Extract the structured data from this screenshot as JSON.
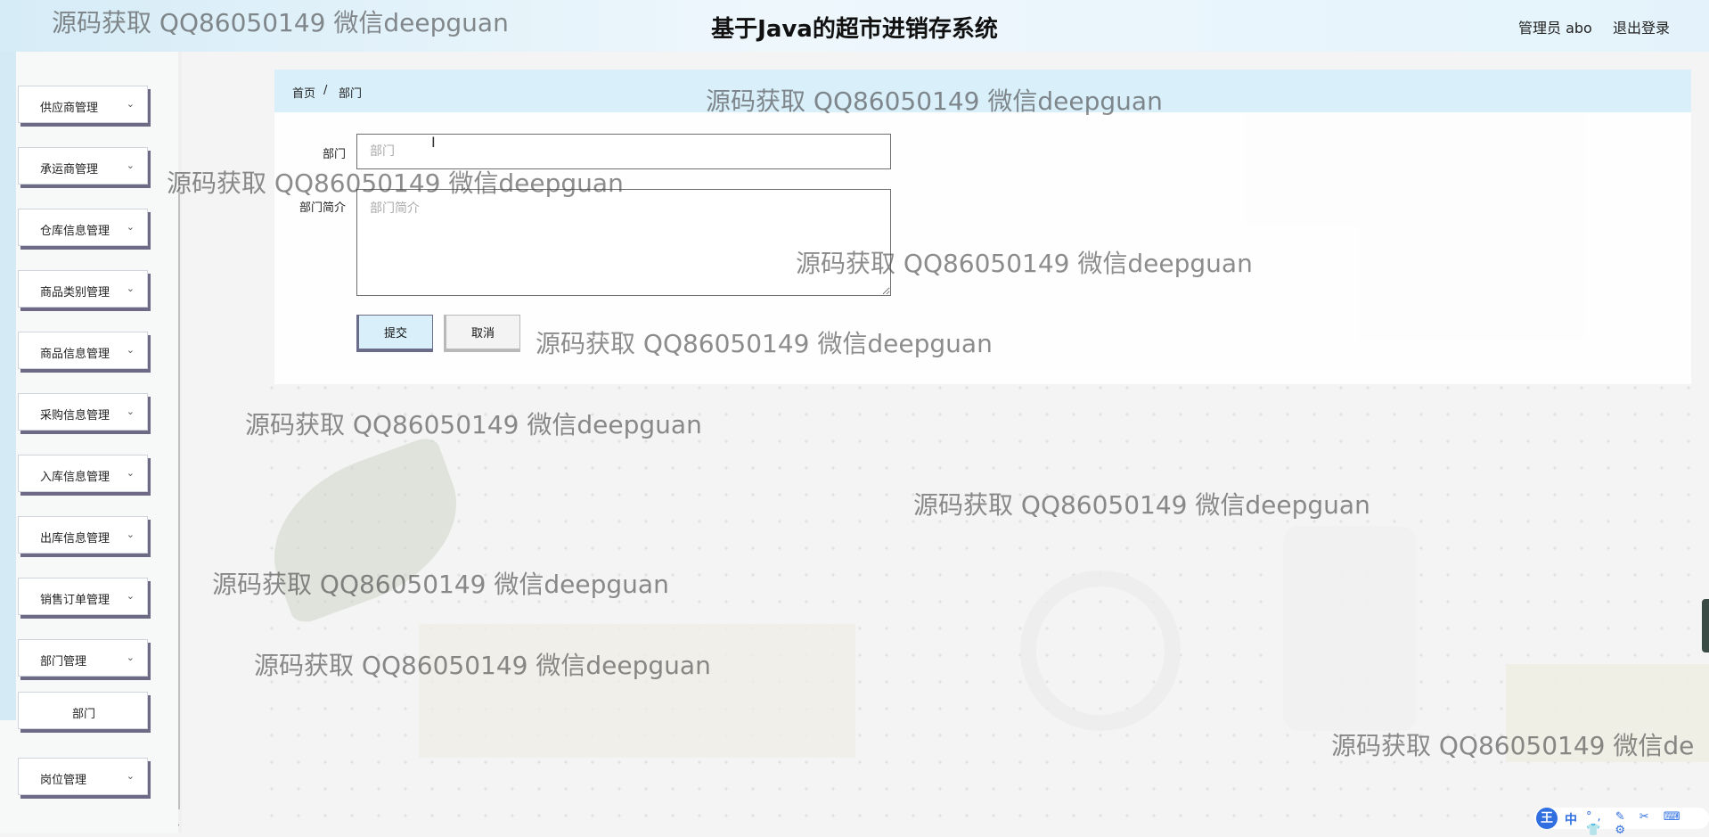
{
  "header": {
    "app_title": "基于Java的超市进销存系统",
    "user_label": "管理员 abo",
    "logout_label": "退出登录"
  },
  "sidebar": {
    "items": [
      {
        "label": "供应商管理",
        "expanded": false
      },
      {
        "label": "承运商管理",
        "expanded": false
      },
      {
        "label": "仓库信息管理",
        "expanded": false
      },
      {
        "label": "商品类别管理",
        "expanded": false
      },
      {
        "label": "商品信息管理",
        "expanded": false
      },
      {
        "label": "采购信息管理",
        "expanded": false
      },
      {
        "label": "入库信息管理",
        "expanded": false
      },
      {
        "label": "出库信息管理",
        "expanded": false
      },
      {
        "label": "销售订单管理",
        "expanded": false
      },
      {
        "label": "部门管理",
        "expanded": true
      },
      {
        "label": "部门",
        "submenu": true
      },
      {
        "label": "岗位管理",
        "expanded": false
      }
    ],
    "chevron_icon": "chevron-down-icon"
  },
  "breadcrumb": {
    "home": "首页",
    "separator": "/",
    "current": "部门"
  },
  "form": {
    "department_label": "部门",
    "department_value": "",
    "department_placeholder": "部门",
    "intro_label": "部门简介",
    "intro_value": "",
    "intro_placeholder": "部门简介",
    "submit_label": "提交",
    "cancel_label": "取消"
  },
  "watermark": {
    "text": "源码获取 QQ86050149 微信deepguan",
    "text_truncated": "源码获取 QQ86050149 微信de"
  },
  "ime_toolbar": {
    "logo": "王",
    "mode": "中",
    "tools": "°, ✎ ✂ ⌨ 👕 ⚙"
  },
  "colors": {
    "header_bg": "#d6ecf7",
    "breadcrumb_bg": "#d9f0fb",
    "sidebar_shadow": "#6e6a86",
    "ime_blue": "#2f6fe0"
  }
}
